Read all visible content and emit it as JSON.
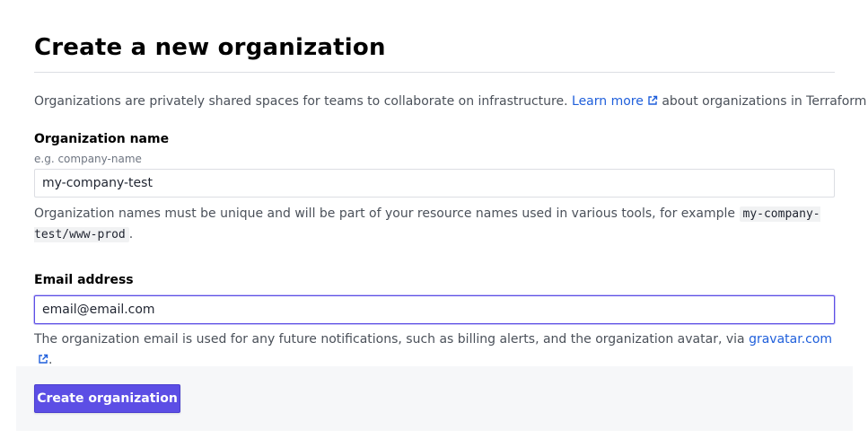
{
  "page": {
    "title": "Create a new organization"
  },
  "intro": {
    "text_before": "Organizations are privately shared spaces for teams to collaborate on infrastructure.",
    "link_label": "Learn more",
    "text_after": "about organizations in Terraform Cloud."
  },
  "org_name": {
    "label": "Organization name",
    "hint": "e.g. company-name",
    "value": "my-company-test",
    "help_text": "Organization names must be unique and will be part of your resource names used in various tools, for example",
    "help_example": "my-company-test/www-prod",
    "help_end": "."
  },
  "email": {
    "label": "Email address",
    "value": "email@email.com",
    "help_text": "The organization email is used for any future notifications, such as billing alerts, and the organization avatar, via",
    "help_link": "gravatar.com",
    "help_end": "."
  },
  "actions": {
    "submit_label": "Create organization"
  },
  "colors": {
    "accent": "#5c4ee5",
    "link": "#1f5fdb"
  },
  "icons": {
    "external_link": "external-link-icon"
  }
}
